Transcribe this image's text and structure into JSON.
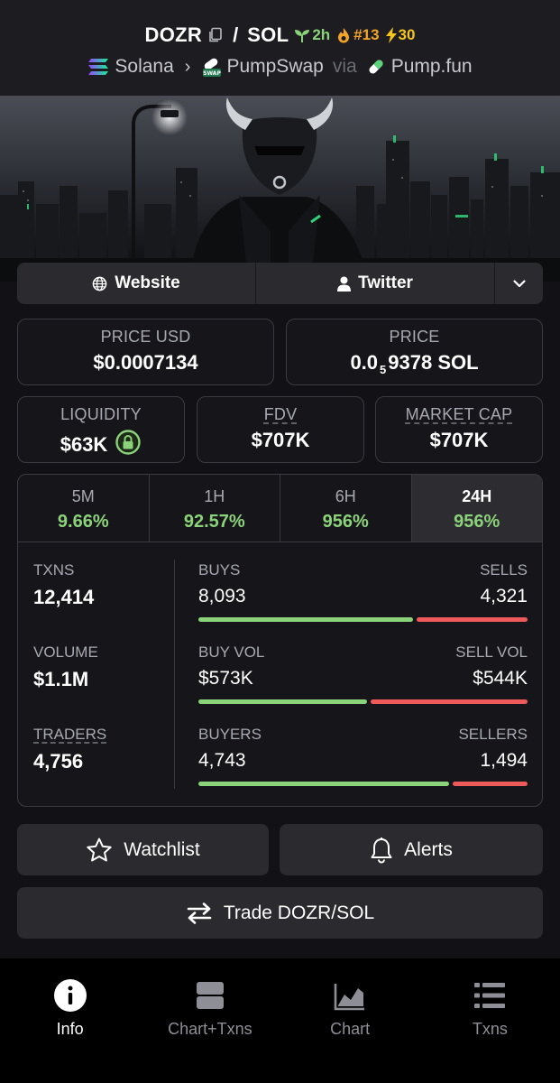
{
  "header": {
    "base_symbol": "DOZR",
    "quote_symbol": "SOL",
    "age": "2h",
    "rank": "#13",
    "boosts": "30",
    "chain": "Solana",
    "dex": "PumpSwap",
    "via_label": "via",
    "launchpad": "Pump.fun"
  },
  "banner": {
    "icon": "bull-mascot-image"
  },
  "links": {
    "website": "Website",
    "twitter": "Twitter"
  },
  "price": {
    "usd_label": "PRICE USD",
    "usd_value": "$0.0007134",
    "native_label": "PRICE",
    "native_prefix": "0.0",
    "native_zeros": "5",
    "native_digits": "9378 SOL"
  },
  "metrics": {
    "liquidity_label": "LIQUIDITY",
    "liquidity_value": "$63K",
    "fdv_label": "FDV",
    "fdv_value": "$707K",
    "mcap_label": "MARKET CAP",
    "mcap_value": "$707K"
  },
  "timeframes": [
    {
      "label": "5M",
      "change": "9.66%"
    },
    {
      "label": "1H",
      "change": "92.57%"
    },
    {
      "label": "6H",
      "change": "956%"
    },
    {
      "label": "24H",
      "change": "956%"
    }
  ],
  "active_timeframe": "24H",
  "stats": {
    "txns_label": "TXNS",
    "txns_value": "12,414",
    "volume_label": "VOLUME",
    "volume_value": "$1.1M",
    "traders_label": "TRADERS",
    "traders_value": "4,756",
    "buys_label": "BUYS",
    "buys_value": "8,093",
    "sells_label": "SELLS",
    "sells_value": "4,321",
    "buy_vol_label": "BUY VOL",
    "buy_vol_value": "$573K",
    "sell_vol_label": "SELL VOL",
    "sell_vol_value": "$544K",
    "buyers_label": "BUYERS",
    "buyers_value": "4,743",
    "sellers_label": "SELLERS",
    "sellers_value": "1,494",
    "buys_ratio": 0.652,
    "buy_vol_ratio": 0.513,
    "buyers_ratio": 0.761
  },
  "actions": {
    "watchlist": "Watchlist",
    "alerts": "Alerts",
    "trade": "Trade DOZR/SOL"
  },
  "nav": [
    {
      "label": "Info",
      "icon": "info-icon"
    },
    {
      "label": "Chart+Txns",
      "icon": "split-view-icon"
    },
    {
      "label": "Chart",
      "icon": "area-chart-icon"
    },
    {
      "label": "Txns",
      "icon": "list-icon"
    }
  ],
  "colors": {
    "green": "#8bd37a",
    "red": "#ee5a5a",
    "orange": "#f5a524",
    "yellow": "#f5c518"
  }
}
